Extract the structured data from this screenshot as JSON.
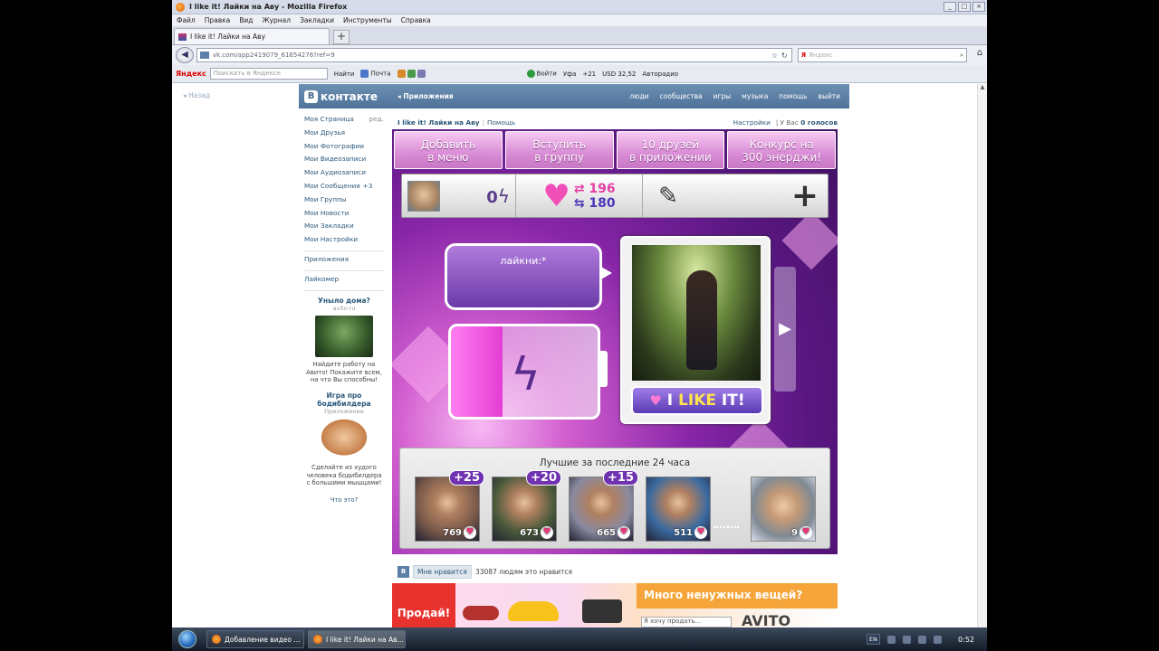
{
  "window": {
    "title": "I like it! Лайки на Аву - Mozilla Firefox",
    "controls": [
      "_",
      "□",
      "×"
    ]
  },
  "menu": [
    "Файл",
    "Правка",
    "Вид",
    "Журнал",
    "Закладки",
    "Инструменты",
    "Справка"
  ],
  "tab": {
    "label": "I like it! Лайки на Аву",
    "new_tab": "+"
  },
  "nav": {
    "url": "vk.com/app2419079_61654276?ref=9",
    "search_logo": "Я",
    "search_placeholder": "Яндекс"
  },
  "yandex_bar": {
    "logo": "Яндекс",
    "search_placeholder": "Поискать в Яндексе",
    "find": "Найти",
    "mail": "Почта",
    "login": "Войти",
    "city": "Уфа",
    "temp": "+21",
    "usd": "USD 32,52",
    "radio": "Авторадио"
  },
  "vk": {
    "logo_mark": "В",
    "logo_text": "контакте",
    "section": "Приложения",
    "nav": [
      "люди",
      "сообщества",
      "игры",
      "музыка",
      "помощь",
      "выйти"
    ],
    "back_link": "Назад"
  },
  "sidebar": {
    "items": [
      {
        "label": "Моя Страница",
        "right": "ред."
      },
      {
        "label": "Мои Друзья",
        "right": ""
      },
      {
        "label": "Мои Фотографии",
        "right": ""
      },
      {
        "label": "Мои Видеозаписи",
        "right": ""
      },
      {
        "label": "Мои Аудиозаписи",
        "right": ""
      },
      {
        "label": "Мои Сообщения",
        "right": "+3"
      },
      {
        "label": "Мои Группы",
        "right": ""
      },
      {
        "label": "Мои Новости",
        "right": ""
      },
      {
        "label": "Мои Закладки",
        "right": ""
      },
      {
        "label": "Мои Настройки",
        "right": ""
      }
    ],
    "apps": [
      "Приложения",
      "Лайкомер"
    ],
    "ad1": {
      "title": "Уныло дома?",
      "site": "avito.ru",
      "text": "Найдите работу на Авито! Покажите всем, на что Вы способны!"
    },
    "ad2": {
      "title": "Игра про бодибилдера",
      "site": "Приложение",
      "text": "Сделайте из худого человека бодибилдера с большими мышцами!"
    },
    "what": "Что это?"
  },
  "app_header": {
    "name": "I like it! Лайки на Аву",
    "help": "Помощь",
    "settings": "Настройки",
    "votes_prefix": "У Вас",
    "votes": "0 голосов"
  },
  "top_buttons": [
    [
      "Добавить",
      "в меню"
    ],
    [
      "Вступить",
      "в группу"
    ],
    [
      "10 друзей",
      "в приложении"
    ],
    [
      "Конкурс на",
      "300 энерджи!"
    ]
  ],
  "stats": {
    "energy": "0",
    "likes_given": "196",
    "likes_received": "180"
  },
  "bubble_text": "лайкни:*",
  "battery_level": 0.35,
  "like_button": {
    "i": "I ",
    "like": "LIKE",
    "it": " IT!"
  },
  "best": {
    "title": "Лучшие за последние 24 часа",
    "users": [
      {
        "bonus": "+25",
        "count": "769",
        "tone": "#7a5a4a"
      },
      {
        "bonus": "+20",
        "count": "673",
        "tone": "#4a5a3a"
      },
      {
        "bonus": "+15",
        "count": "665",
        "tone": "#8a8aa0"
      },
      {
        "bonus": "",
        "count": "511",
        "tone": "#3a6aa0"
      }
    ],
    "self": {
      "count": "9"
    }
  },
  "likebar": {
    "vk": "В",
    "button": "Мне нравится",
    "text": "33087 людям это нравится"
  },
  "banner": {
    "sell": "Продай!",
    "headline": "Много ненужных вещей?",
    "brand": "AVITO",
    "input": "Я хочу продать..."
  },
  "taskbar": {
    "tasks": [
      "Добавление видео ...",
      "I like it! Лайки на Ав..."
    ],
    "lang": "EN",
    "time": "0:52"
  }
}
